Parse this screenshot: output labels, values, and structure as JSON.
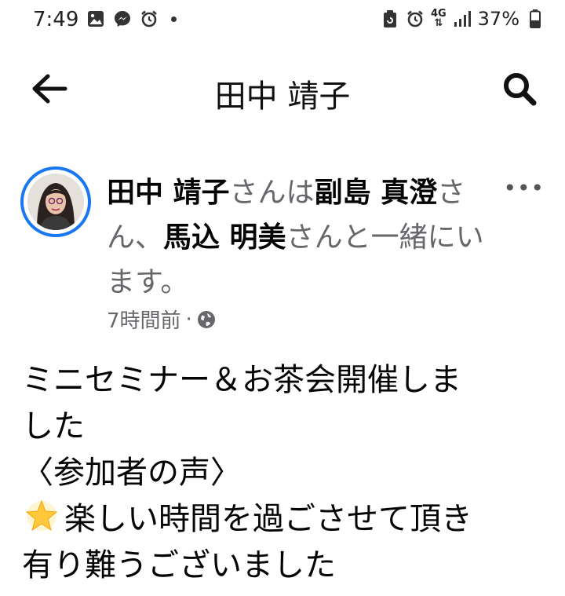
{
  "status_bar": {
    "time": "7:49",
    "network": "4G",
    "battery": "37%",
    "icons_left": [
      "gallery-icon",
      "messenger-icon",
      "alarm-icon",
      "notification-dot"
    ],
    "icons_right": [
      "recycle-icon",
      "alarm-icon",
      "network-4g-icon",
      "signal-icon",
      "battery-icon"
    ]
  },
  "header": {
    "title": "田中 靖子"
  },
  "post": {
    "author_line": {
      "author": "田中 靖子",
      "mid1": "さんは",
      "friend1": "副島 真澄",
      "mid2": "さん、",
      "friend2": "馬込 明美",
      "tail": "さんと一緒にいます。"
    },
    "time_ago": "7時間前",
    "separator": "·",
    "privacy_icon": "globe-icon",
    "more_label": "•••",
    "body_lines": [
      "ミニセミナー＆お茶会開催しま",
      "した",
      "〈参加者の声〉",
      "楽しい時間を過ごさせて頂き",
      "有り難うございました"
    ],
    "emoji": "glowing-star-icon"
  },
  "colors": {
    "accent": "#1877f2",
    "secondary_text": "#65676b",
    "primary_text": "#050505"
  }
}
